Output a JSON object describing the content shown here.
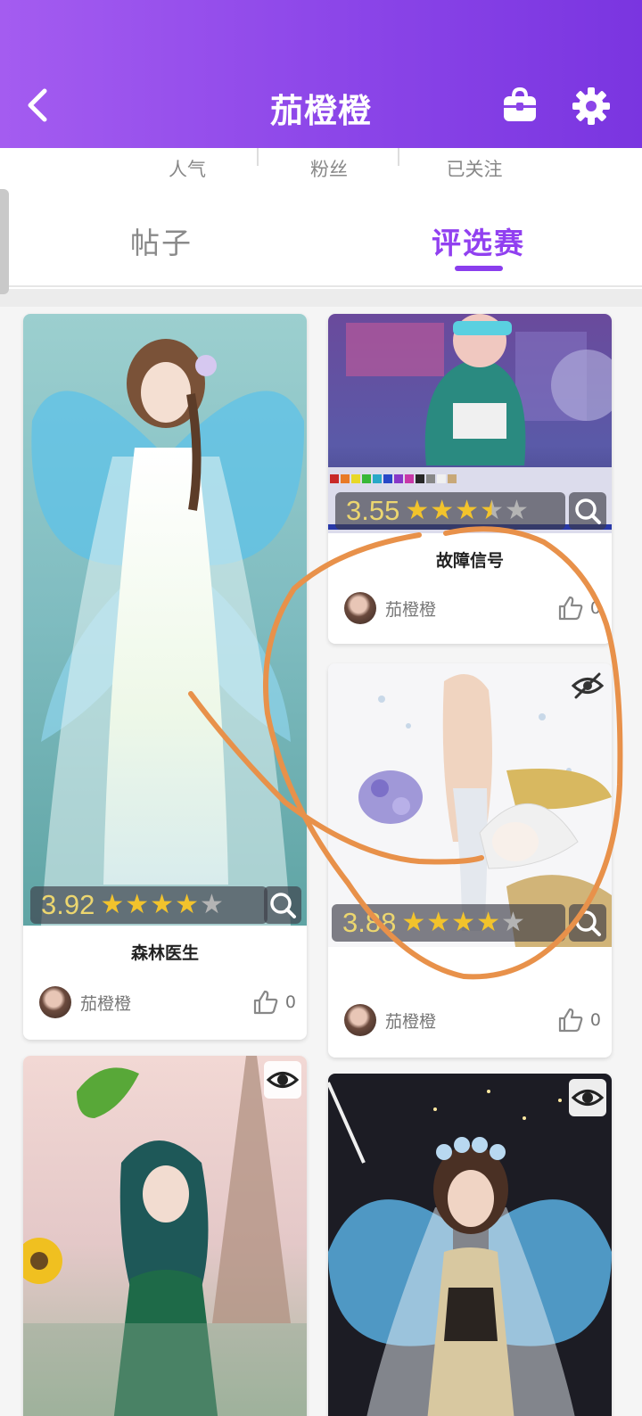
{
  "header": {
    "title": "茄橙橙",
    "background_color": "#8b45e8"
  },
  "stats": [
    {
      "label": "人气"
    },
    {
      "label": "粉丝"
    },
    {
      "label": "已关注"
    }
  ],
  "tabs": [
    {
      "label": "帖子",
      "active": false
    },
    {
      "label": "评选赛",
      "active": true
    }
  ],
  "cards": [
    {
      "rating": "3.92",
      "stars": 4,
      "title": "森林医生",
      "author": "茄橙橙",
      "likes": "0"
    },
    {
      "rating": "3.55",
      "stars": 3.5,
      "title": "故障信号",
      "author": "茄橙橙",
      "likes": "0"
    },
    {
      "rating": "3.88",
      "stars": 4,
      "title": "",
      "author": "茄橙橙",
      "likes": "0"
    },
    {
      "rating": "",
      "title": "",
      "author": "",
      "likes": ""
    },
    {
      "rating": "",
      "title": "",
      "author": "",
      "likes": ""
    }
  ],
  "colors": {
    "accent": "#8a3ded",
    "star": "#f2c32c",
    "rating_text": "#ecd66f",
    "annotation": "#e8914a"
  },
  "icons": [
    "back-arrow-icon",
    "bag-icon",
    "gear-icon",
    "search-icon",
    "eye-icon",
    "eye-off-icon",
    "thumb-up-icon"
  ]
}
